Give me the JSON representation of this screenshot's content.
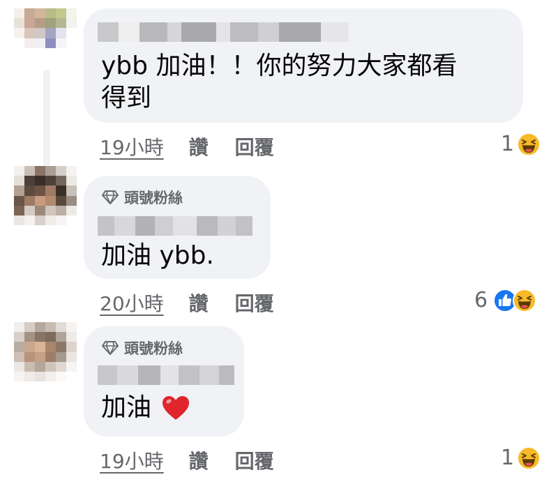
{
  "comments": [
    {
      "author": "",
      "badge": "",
      "text_lines": [
        "ybb 加油！！你的努力大家都看",
        "得到"
      ],
      "time": "19小時",
      "like_label": "讚",
      "reply_label": "回覆",
      "reaction_count": "1",
      "reaction_icons": [
        "haha-icon"
      ]
    },
    {
      "author": "",
      "badge": "頭號粉絲",
      "text_lines": [
        "加油 ybb."
      ],
      "time": "20小時",
      "like_label": "讚",
      "reply_label": "回覆",
      "reaction_count": "6",
      "reaction_icons": [
        "like-icon",
        "haha-icon"
      ]
    },
    {
      "author": "",
      "badge": "頭號粉絲",
      "text_lines": [
        "加油"
      ],
      "text_emoji": "heart-icon",
      "time": "19小時",
      "like_label": "讚",
      "reply_label": "回覆",
      "reaction_count": "1",
      "reaction_icons": [
        "haha-icon"
      ]
    }
  ],
  "colors": {
    "bubble": "#f0f2f5",
    "meta_text": "#65676b",
    "like_blue": "#1877f2",
    "haha_yellow": "#f7b928",
    "heart_red": "#e0252c"
  }
}
